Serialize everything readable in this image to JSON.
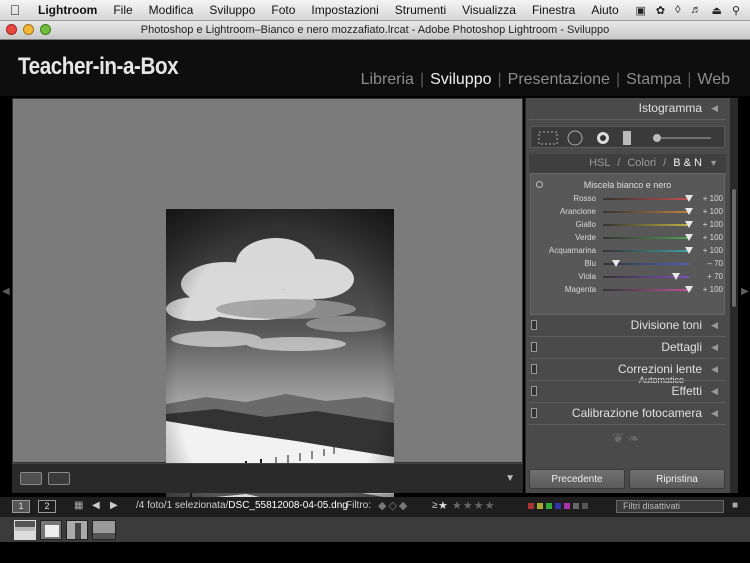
{
  "menubar": {
    "app": "Lightroom",
    "items": [
      "File",
      "Modifica",
      "Sviluppo",
      "Foto",
      "Impostazioni",
      "Strumenti",
      "Visualizza",
      "Finestra",
      "Aiuto"
    ]
  },
  "window": {
    "title": "Photoshop e Lightroom–Bianco e nero mozzafiato.lrcat - Adobe Photoshop Lightroom - Sviluppo"
  },
  "header": {
    "identity": "Teacher-in-a-Box",
    "modules": [
      {
        "label": "Libreria",
        "active": false
      },
      {
        "label": "Sviluppo",
        "active": true
      },
      {
        "label": "Presentazione",
        "active": false
      },
      {
        "label": "Stampa",
        "active": false
      },
      {
        "label": "Web",
        "active": false
      }
    ],
    "sep": "|"
  },
  "panel": {
    "histogram": "Istogramma",
    "hsl_tabs": {
      "hsl": "HSL",
      "slash": "/",
      "colori": "Colori",
      "bw": "B & N"
    },
    "bw_title": "Miscela bianco e nero",
    "bw_mix": [
      {
        "label": "Rosso",
        "value": "+ 100",
        "pos": 1.0,
        "color": "#c05050"
      },
      {
        "label": "Arancione",
        "value": "+ 100",
        "pos": 1.0,
        "color": "#c08040"
      },
      {
        "label": "Giallo",
        "value": "+ 100",
        "pos": 1.0,
        "color": "#c0b040"
      },
      {
        "label": "Verde",
        "value": "+ 100",
        "pos": 1.0,
        "color": "#50a050"
      },
      {
        "label": "Acquamarina",
        "value": "+ 100",
        "pos": 1.0,
        "color": "#40a0a0"
      },
      {
        "label": "Blu",
        "value": "– 70",
        "pos": 0.15,
        "color": "#5060c0"
      },
      {
        "label": "Viola",
        "value": "+ 70",
        "pos": 0.85,
        "color": "#8050c0"
      },
      {
        "label": "Magenta",
        "value": "+ 100",
        "pos": 1.0,
        "color": "#c050a0"
      }
    ],
    "auto_label": "Automatico",
    "sections": [
      "Divisione toni",
      "Dettagli",
      "Correzioni lente",
      "Effetti",
      "Calibrazione fotocamera"
    ],
    "prev_button": "Precedente",
    "reset_button": "Ripristina"
  },
  "filmbar": {
    "view1": "1",
    "view2": "2",
    "path_prefix": "/4 foto/1 selezionata/",
    "filename": "DSC_55812008-04-05.dng",
    "filter_label": "Filtro:",
    "ge": "≥",
    "filter_select": "Filtri disattivati"
  },
  "toolbar": {
    "view_icons": [
      "loupe-icon",
      "compare-icon"
    ]
  }
}
